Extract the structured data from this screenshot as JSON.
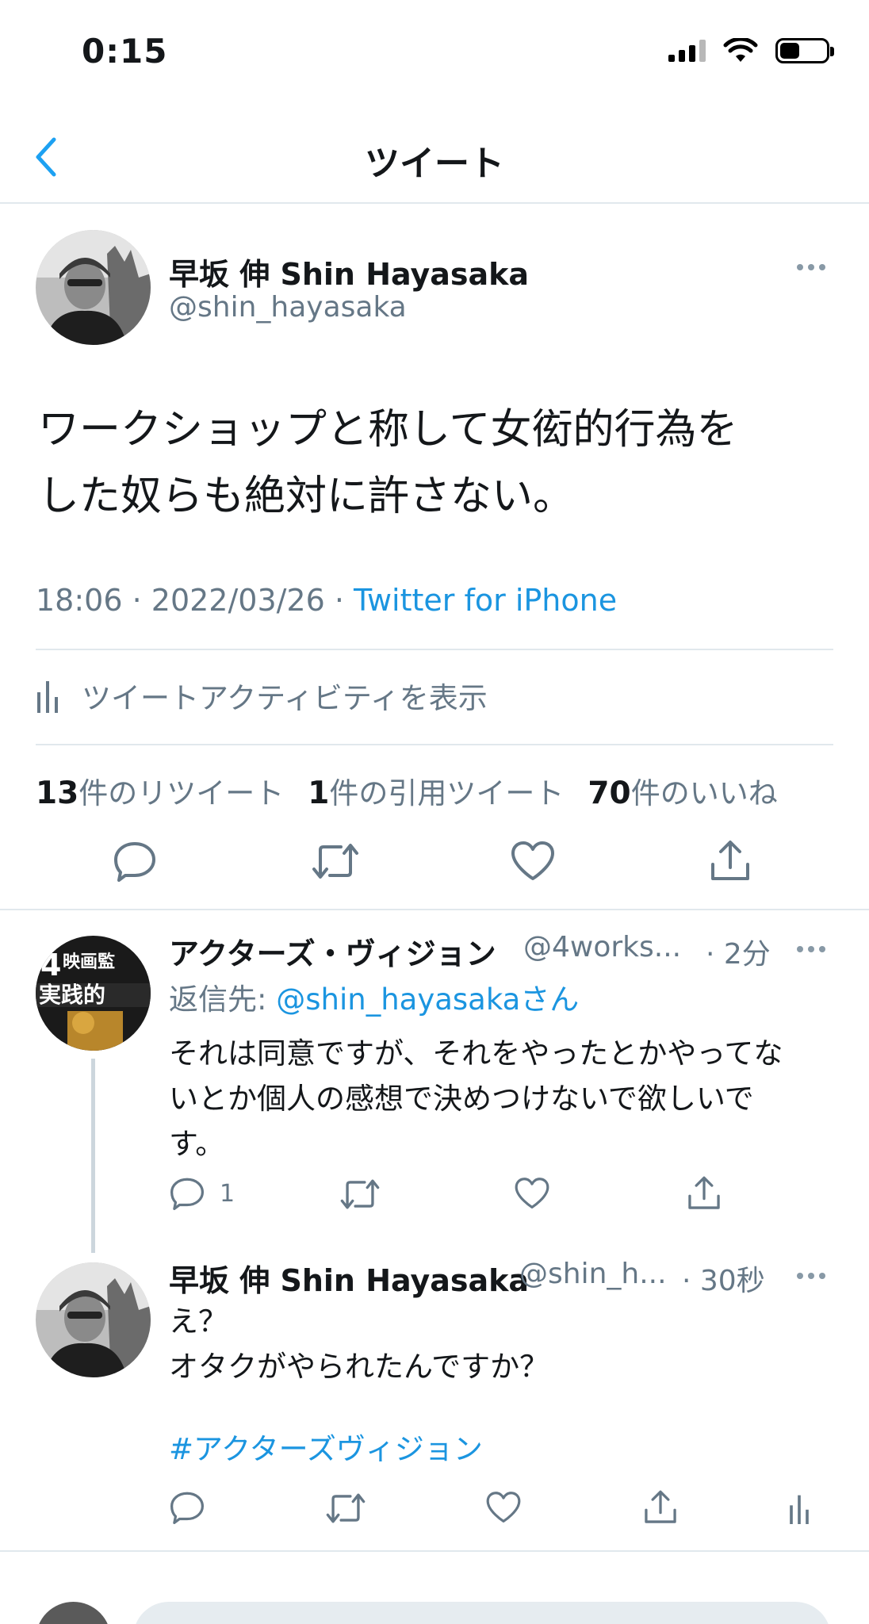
{
  "status_bar": {
    "time": "0:15"
  },
  "nav": {
    "title": "ツイート"
  },
  "main_tweet": {
    "author_name": "早坂 伸 Shin Hayasaka",
    "author_handle": "@shin_hayasaka",
    "text_line1": "ワークショップと称して女衒的行為を",
    "text_line2": "した奴らも絶対に許さない。",
    "time": "18:06",
    "date": "2022/03/26",
    "separator": " · ",
    "source": "Twitter for iPhone",
    "activity_label": "ツイートアクティビティを表示",
    "retweet_count": "13",
    "retweet_label": "件のリツイート",
    "quote_count": "1",
    "quote_label": "件の引用ツイート",
    "like_count": "70",
    "like_label": "件のいいね"
  },
  "reply1": {
    "author_name": "アクターズ・ヴィジョン",
    "author_handle": "@4works...",
    "time": "· 2分",
    "reply_to_prefix": "返信先: ",
    "reply_to_handle": "@shin_hayasaka",
    "reply_to_suffix": "さん",
    "text_line1": "それは同意ですが、それをやったとかやってな",
    "text_line2": "いとか個人の感想で決めつけないで欲しいで",
    "text_line3": "す。",
    "reply_count": "1"
  },
  "reply2": {
    "author_name": "早坂 伸 Shin Hayasaka",
    "author_handle": "@shin_h...",
    "time": "· 30秒",
    "text_line1": "え？",
    "text_line2": "オタクがやられたんですか？",
    "hashtag": "#アクターズヴィジョン"
  },
  "icons": [
    "chevron-left-icon",
    "more-icon",
    "reply-icon",
    "retweet-icon",
    "like-icon",
    "share-icon",
    "analytics-icon"
  ],
  "colors": {
    "accent": "#1da1f2",
    "link": "#1b95e0",
    "secondary": "#657786",
    "divider": "#e1e8ed"
  }
}
